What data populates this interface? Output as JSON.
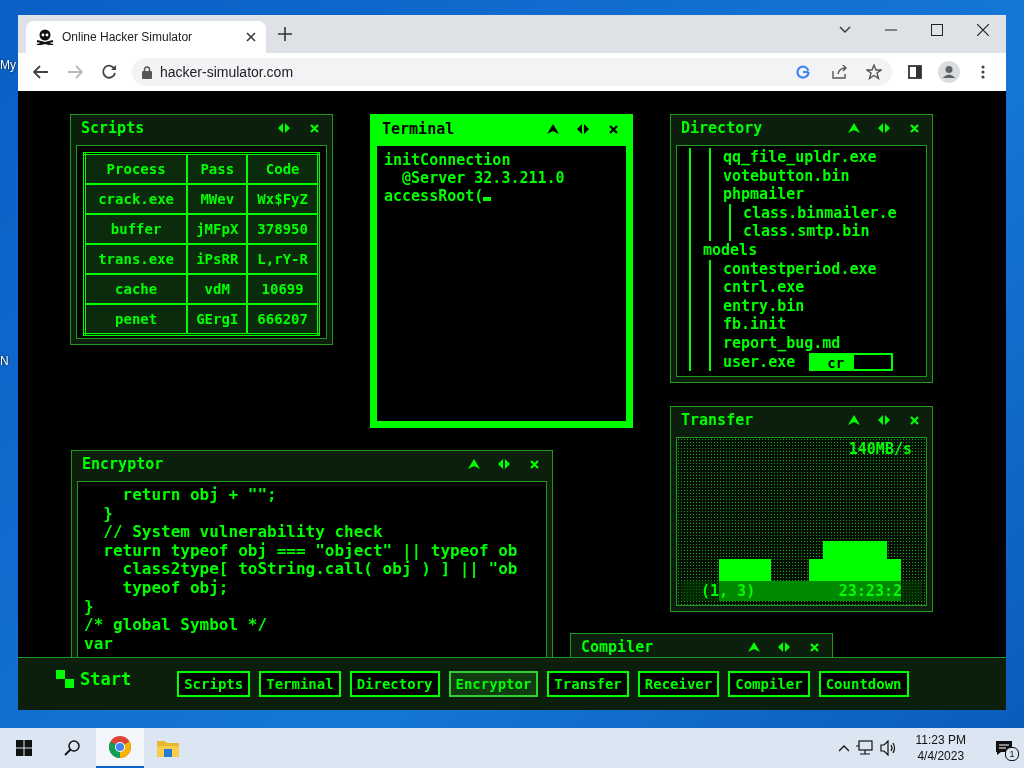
{
  "desktop": {
    "icon_labels": [
      "My",
      "N"
    ]
  },
  "browser": {
    "tab": {
      "title": "Online Hacker Simulator"
    },
    "url": "hacker-simulator.com",
    "forward_disabled": true
  },
  "windows": [
    {
      "title": "Scripts",
      "active": false,
      "collapsible": false
    },
    {
      "title": "Terminal",
      "active": true,
      "collapsible": true
    },
    {
      "title": "Directory",
      "active": false,
      "collapsible": true
    },
    {
      "title": "Transfer",
      "active": false,
      "collapsible": true
    },
    {
      "title": "Encryptor",
      "active": false,
      "collapsible": true
    },
    {
      "title": "Compiler",
      "active": false,
      "collapsible": true
    }
  ],
  "scripts": {
    "columns": [
      "Process",
      "Pass",
      "Code"
    ],
    "rows": [
      [
        "crack.exe",
        "MWev",
        "Wx$FyZ"
      ],
      [
        "buffer",
        "jMFpX",
        "378950"
      ],
      [
        "trans.exe",
        "iPsRR",
        "L,rY-R"
      ],
      [
        "cache",
        "vdM",
        "10699"
      ],
      [
        "penet",
        "GErgI",
        "666207"
      ]
    ]
  },
  "terminal": {
    "lines": [
      "initConnection",
      "  @Server 32.3.211.0",
      "accessRoot("
    ]
  },
  "directory": {
    "tree": [
      {
        "children": [
          {
            "children": [
              {
                "name": "qq_file_upldr.exe"
              },
              {
                "name": "votebutton.bin"
              },
              {
                "name": "phpmailer",
                "children": [
                  {
                    "name": "class.binmailer.e"
                  },
                  {
                    "name": "class.smtp.bin"
                  }
                ]
              }
            ]
          },
          {
            "name": "models",
            "children": [
              {
                "name": "contestperiod.exe"
              },
              {
                "name": "cntrl.exe"
              },
              {
                "name": "entry.bin"
              },
              {
                "name": "fb.init"
              },
              {
                "name": "report_bug.md"
              },
              {
                "name": "user.exe",
                "progress": {
                  "label": "cr",
                  "level": 0.55
                }
              }
            ]
          }
        ]
      }
    ]
  },
  "transfer": {
    "rate": "140MB/s",
    "position": "(1, 3)",
    "time": "23:23:2"
  },
  "encryptor": {
    "lines": [
      "    return obj + \"\";",
      "  }",
      "  // System vulnerability check",
      "  return typeof obj === \"object\" || typeof ob",
      "    class2type[ toString.call( obj ) ] || \"ob",
      "    typeof obj;",
      "}",
      "/* global Symbol */",
      "var"
    ]
  },
  "hacker_taskbar": {
    "start": "Start",
    "buttons": [
      {
        "label": "Scripts",
        "selected": false
      },
      {
        "label": "Terminal",
        "selected": false
      },
      {
        "label": "Directory",
        "selected": false
      },
      {
        "label": "Encryptor",
        "selected": true
      },
      {
        "label": "Transfer",
        "selected": false
      },
      {
        "label": "Receiver",
        "selected": false
      },
      {
        "label": "Compiler",
        "selected": false
      },
      {
        "label": "Countdown",
        "selected": false
      }
    ]
  },
  "taskbar": {
    "apps": [
      {
        "kind": "browser",
        "selected": true
      },
      {
        "kind": "folder",
        "selected": false
      }
    ],
    "time": "11:23 PM",
    "date": "4/4/2023",
    "notifications": "1"
  }
}
